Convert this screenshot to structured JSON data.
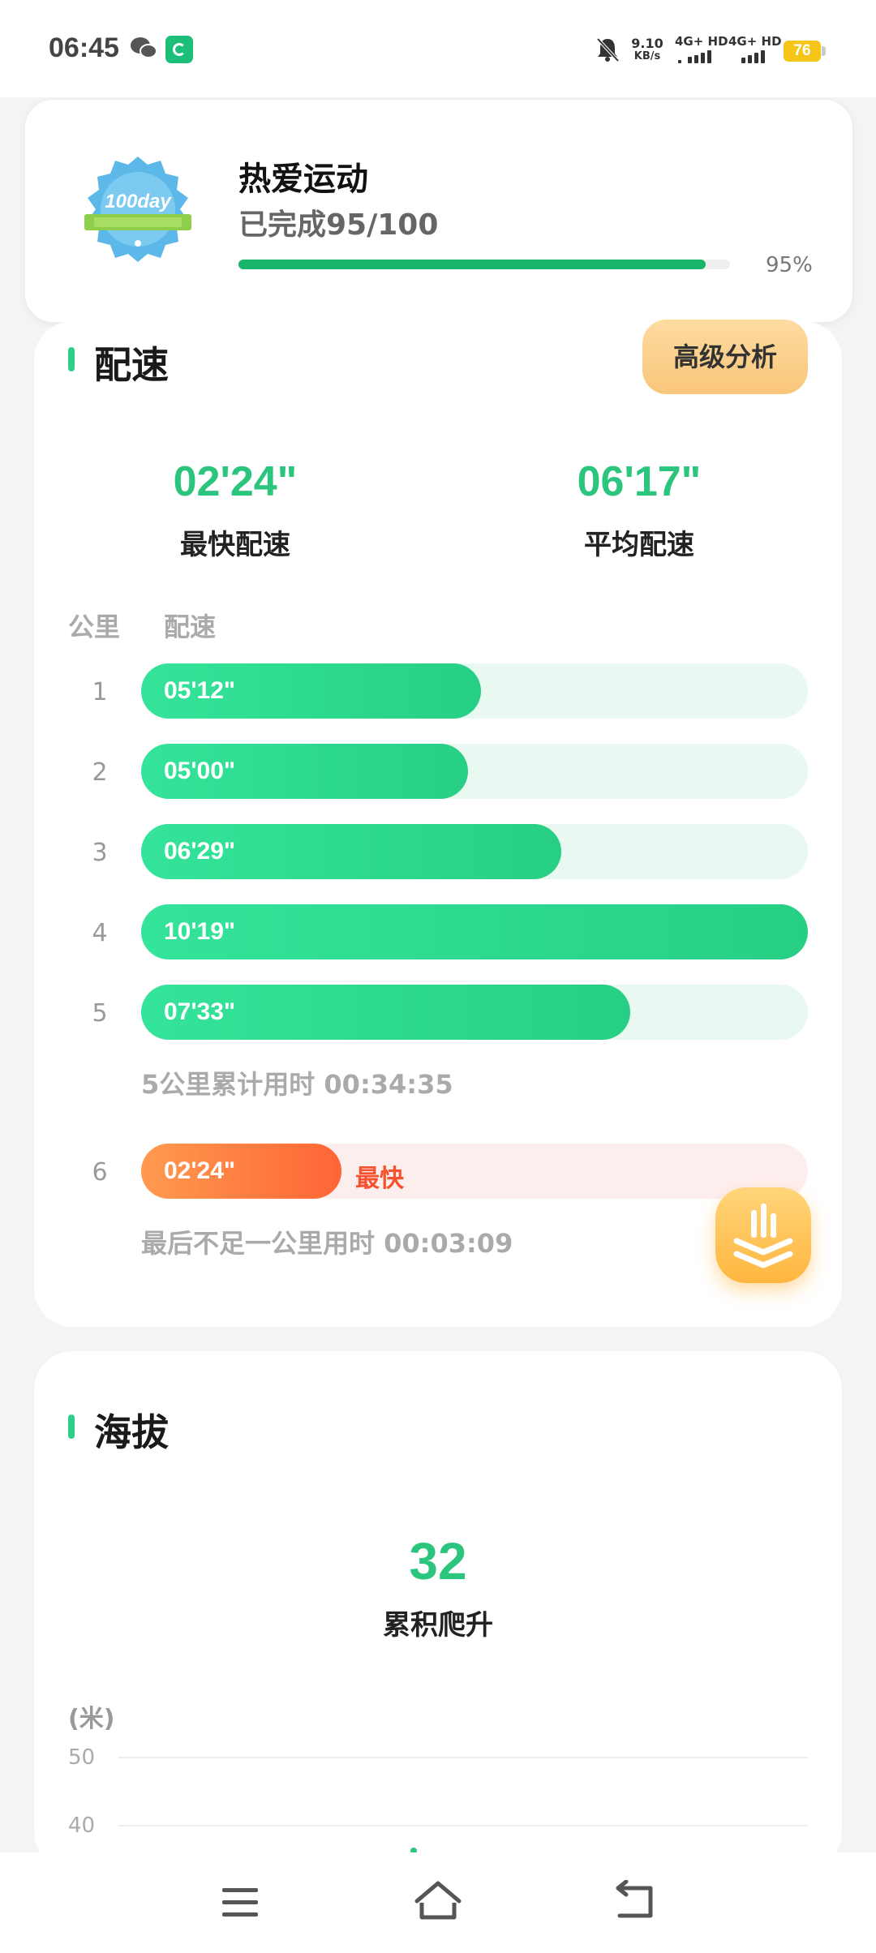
{
  "status_bar": {
    "time": "06:45",
    "net_speed_value": "9.10",
    "net_speed_unit": "KB/s",
    "sim1": "4G+ HD",
    "sim2": "4G+ HD",
    "battery": "76"
  },
  "achievement": {
    "badge_text": "100day",
    "title": "热爱运动",
    "progress_text": "已完成95/100",
    "progress_fraction": 0.95,
    "progress_pct": "95%"
  },
  "pace": {
    "title": "配速",
    "advanced_button": "高级分析",
    "fastest_value": "02'24\"",
    "fastest_label": "最快配速",
    "average_value": "06'17\"",
    "average_label": "平均配速",
    "col_km": "公里",
    "col_pace": "配速",
    "rows": [
      {
        "km": "1",
        "pace": "05'12\"",
        "fraction": 0.51
      },
      {
        "km": "2",
        "pace": "05'00\"",
        "fraction": 0.49
      },
      {
        "km": "3",
        "pace": "06'29\"",
        "fraction": 0.63
      },
      {
        "km": "4",
        "pace": "10'19\"",
        "fraction": 1.0
      },
      {
        "km": "5",
        "pace": "07'33\"",
        "fraction": 0.734
      }
    ],
    "total_note": "5公里累计用时 00:34:35",
    "last_row": {
      "km": "6",
      "pace": "02'24\"",
      "fraction": 0.3,
      "tag": "最快"
    },
    "last_note": "最后不足一公里用时 00:03:09"
  },
  "altitude": {
    "title": "海拔",
    "value": "32",
    "label": "累积爬升",
    "unit": "(米)",
    "y_ticks": [
      "50",
      "40"
    ]
  },
  "colors": {
    "green": "#2cc57e",
    "orange": "#ff6536",
    "gold": "#f9c67a"
  }
}
